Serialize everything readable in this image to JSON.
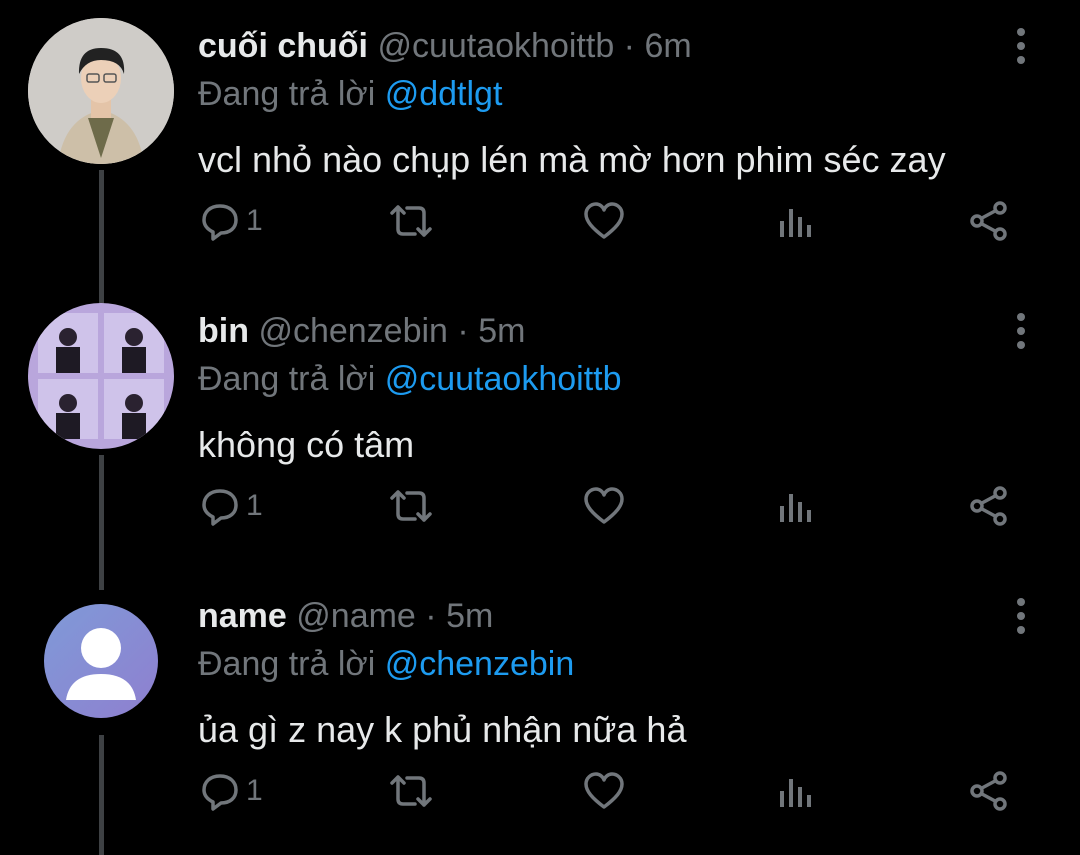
{
  "tweets": [
    {
      "display_name": "cuối chuối",
      "handle": "@cuutaokhoittb",
      "time": "6m",
      "reply_prefix": "Đang trả lời",
      "reply_to": "@ddtlgt",
      "text": "vcl nhỏ nào chụp lén mà mờ hơn phim séc zay",
      "reply_count": "1",
      "avatar": "person-photo"
    },
    {
      "display_name": "bin",
      "handle": "@chenzebin",
      "time": "5m",
      "reply_prefix": "Đang trả lời",
      "reply_to": "@cuutaokhoittb",
      "text": "không có tâm",
      "reply_count": "1",
      "avatar": "photo-collage"
    },
    {
      "display_name": "name",
      "handle": "@name",
      "time": "5m",
      "reply_prefix": "Đang trả lời",
      "reply_to": "@chenzebin",
      "text": "ủa gì z nay k phủ nhận nữa hả",
      "reply_count": "1",
      "avatar": "default-avatar"
    }
  ],
  "separator": " · ",
  "colors": {
    "text": "#e7e9ea",
    "muted": "#71767b",
    "link": "#1d9bf0",
    "thread": "#3e4144"
  },
  "icons": [
    "reply-icon",
    "retweet-icon",
    "like-icon",
    "views-icon",
    "share-icon",
    "more-icon"
  ]
}
